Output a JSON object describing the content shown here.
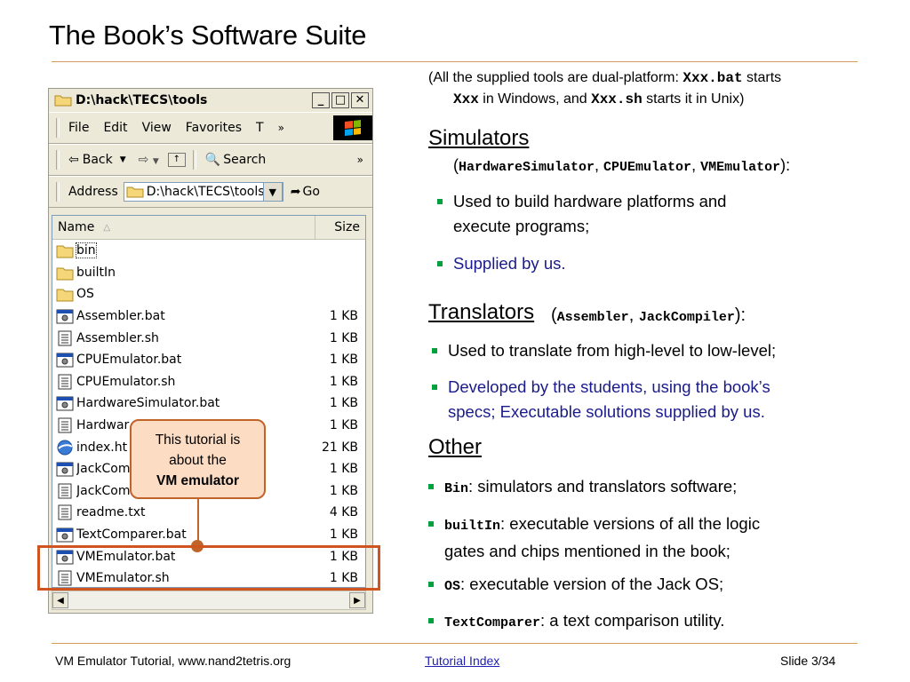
{
  "slide": {
    "title": "The Book’s Software Suite",
    "footer_left": "VM Emulator Tutorial, www.nand2tetris.org",
    "footer_link": "Tutorial Index",
    "footer_right": "Slide 3/34"
  },
  "explorer": {
    "window_title": "D:\\hack\\TECS\\tools",
    "menu": [
      "File",
      "Edit",
      "View",
      "Favorites",
      "T"
    ],
    "toolbar": {
      "back": "Back",
      "search": "Search"
    },
    "address_label": "Address",
    "address_value": "D:\\hack\\TECS\\tools",
    "go_label": "Go",
    "col_name": "Name",
    "col_size": "Size",
    "files": [
      {
        "name": "bin",
        "size": "",
        "icon": "folder-icon"
      },
      {
        "name": "builtIn",
        "size": "",
        "icon": "folder-icon"
      },
      {
        "name": "OS",
        "size": "",
        "icon": "folder-icon"
      },
      {
        "name": "Assembler.bat",
        "size": "1 KB",
        "icon": "batch-file-icon"
      },
      {
        "name": "Assembler.sh",
        "size": "1 KB",
        "icon": "text-file-icon"
      },
      {
        "name": "CPUEmulator.bat",
        "size": "1 KB",
        "icon": "batch-file-icon"
      },
      {
        "name": "CPUEmulator.sh",
        "size": "1 KB",
        "icon": "text-file-icon"
      },
      {
        "name": "HardwareSimulator.bat",
        "size": "1 KB",
        "icon": "batch-file-icon"
      },
      {
        "name": "Hardwar",
        "size": "1 KB",
        "icon": "text-file-icon"
      },
      {
        "name": "index.ht",
        "size": "21 KB",
        "icon": "html-file-icon"
      },
      {
        "name": "JackCom",
        "size": "1 KB",
        "icon": "batch-file-icon"
      },
      {
        "name": "JackCom",
        "size": "1 KB",
        "icon": "text-file-icon"
      },
      {
        "name": "readme.txt",
        "size": "4 KB",
        "icon": "text-file-icon"
      },
      {
        "name": "TextComparer.bat",
        "size": "1 KB",
        "icon": "batch-file-icon"
      },
      {
        "name": "VMEmulator.bat",
        "size": "1 KB",
        "icon": "batch-file-icon"
      },
      {
        "name": "VMEmulator.sh",
        "size": "1 KB",
        "icon": "text-file-icon"
      }
    ]
  },
  "callout": {
    "line1": "This tutorial is",
    "line2": "about the",
    "line3": "VM emulator"
  },
  "intro": {
    "p1": "(All the supplied tools are dual-platform: ",
    "m1": "Xxx.bat",
    "p2": " starts",
    "m2": "Xxx",
    "p3": " in Windows, and ",
    "m3": "Xxx.sh",
    "p4": " starts it in Unix)"
  },
  "simulators": {
    "heading": "Simulators",
    "open": "(",
    "t1": "HardwareSimulator",
    "c1": ", ",
    "t2": "CPUEmulator",
    "c2": ", ",
    "t3": "VMEmulator",
    "close": "):",
    "b1a": "Used to build hardware platforms and",
    "b1b": "execute programs;",
    "b2": "Supplied by us."
  },
  "translators": {
    "heading": "Translators ",
    "open": "(",
    "t1": "Assembler",
    "c1": ", ",
    "t2": "JackCompiler",
    "close": "):",
    "b1": "Used to translate from high-level to low-level;",
    "b2a": "Developed by the students, using the book’s",
    "b2b": "specs; Executable solutions supplied by us."
  },
  "other": {
    "heading": "Other",
    "b1m": "Bin",
    "b1t": ": simulators and translators software;",
    "b2m": "builtIn",
    "b2t": ": executable versions of all the logic",
    "b2t2": "gates and chips mentioned in the book;",
    "b3m": "OS",
    "b3t": ": executable version of the Jack OS;",
    "b4m": "TextComparer",
    "b4t": ": a text comparison utility."
  },
  "colors": {
    "accent": "#c0642a",
    "callout_bg": "#fcdcc3",
    "bullet": "#00a03c",
    "blue_text": "#1a1a8c"
  }
}
